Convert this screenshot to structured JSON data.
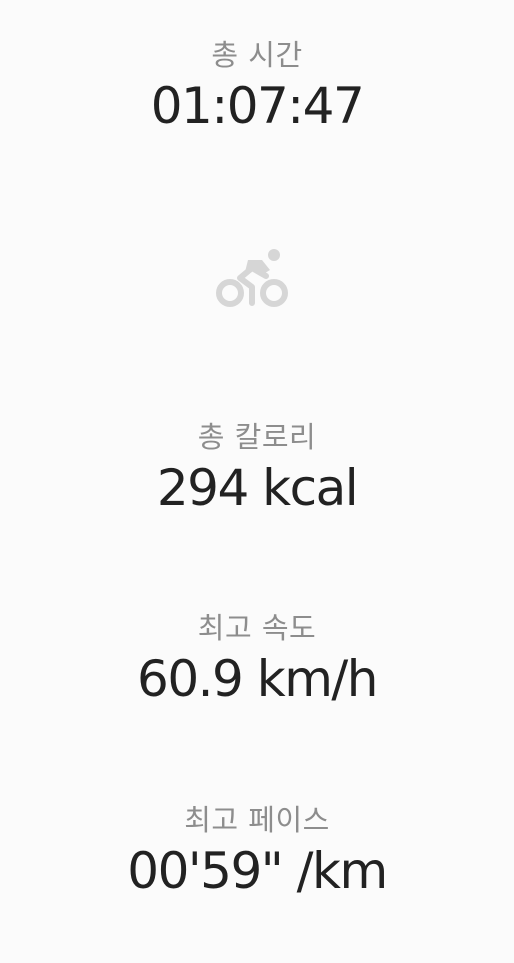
{
  "stats": {
    "total_time": {
      "label": "총 시간",
      "value": "01:07:47"
    },
    "calories": {
      "label": "총 칼로리",
      "value": "294 kcal"
    },
    "max_speed": {
      "label": "최고 속도",
      "value": "60.9 km/h"
    },
    "best_pace": {
      "label": "최고 페이스",
      "value": "00'59\" /km"
    }
  },
  "activity": {
    "icon": "cycling-icon",
    "color": "#d6d6d6"
  },
  "colors": {
    "background": "#fbfbfb",
    "label": "#8d8d8d",
    "value": "#222222"
  }
}
